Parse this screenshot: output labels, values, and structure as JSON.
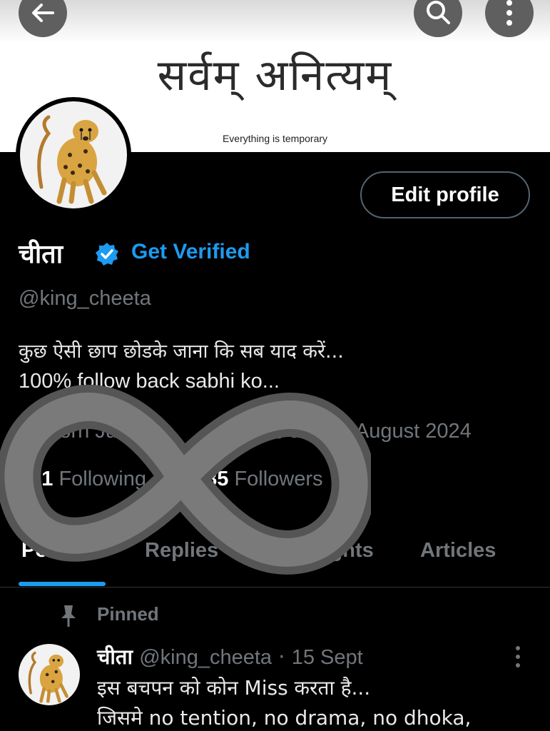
{
  "banner": {
    "title": "सर्वम् अनित्यम्",
    "subtitle": "Everything is temporary"
  },
  "top_bar": {
    "back_icon": "arrow-left-icon",
    "search_icon": "search-icon",
    "more_icon": "more-vertical-icon"
  },
  "profile": {
    "edit_label": "Edit profile",
    "name": "चीता",
    "verified_icon": "verified-badge-icon",
    "get_verified_label": "Get Verified",
    "handle": "@king_cheeta",
    "bio_line1": "कुछ ऐसी छाप छोडके जाना कि सब याद करें...",
    "bio_line2": "100% follow back sabhi ko...",
    "born_text": "Born July",
    "joined_text": "Joined August 2024",
    "following_count": "401",
    "following_label": "Following",
    "followers_count": "385",
    "followers_label": "Followers"
  },
  "tabs": [
    {
      "label": "Posts"
    },
    {
      "label": "Replies"
    },
    {
      "label": "Highlights"
    },
    {
      "label": "Articles"
    }
  ],
  "pinned": {
    "label": "Pinned",
    "icon": "pin-icon"
  },
  "post": {
    "author_name": "चीता",
    "author_handle": "@king_cheeta",
    "separator": "·",
    "date": "15 Sept",
    "line1": "इस बचपन को कोन Miss करता है...",
    "line2": "जिसमे no tention, no drama, no dhoka,"
  },
  "colors": {
    "accent": "#1d9bf0",
    "muted": "#71767b",
    "background": "#000000"
  }
}
